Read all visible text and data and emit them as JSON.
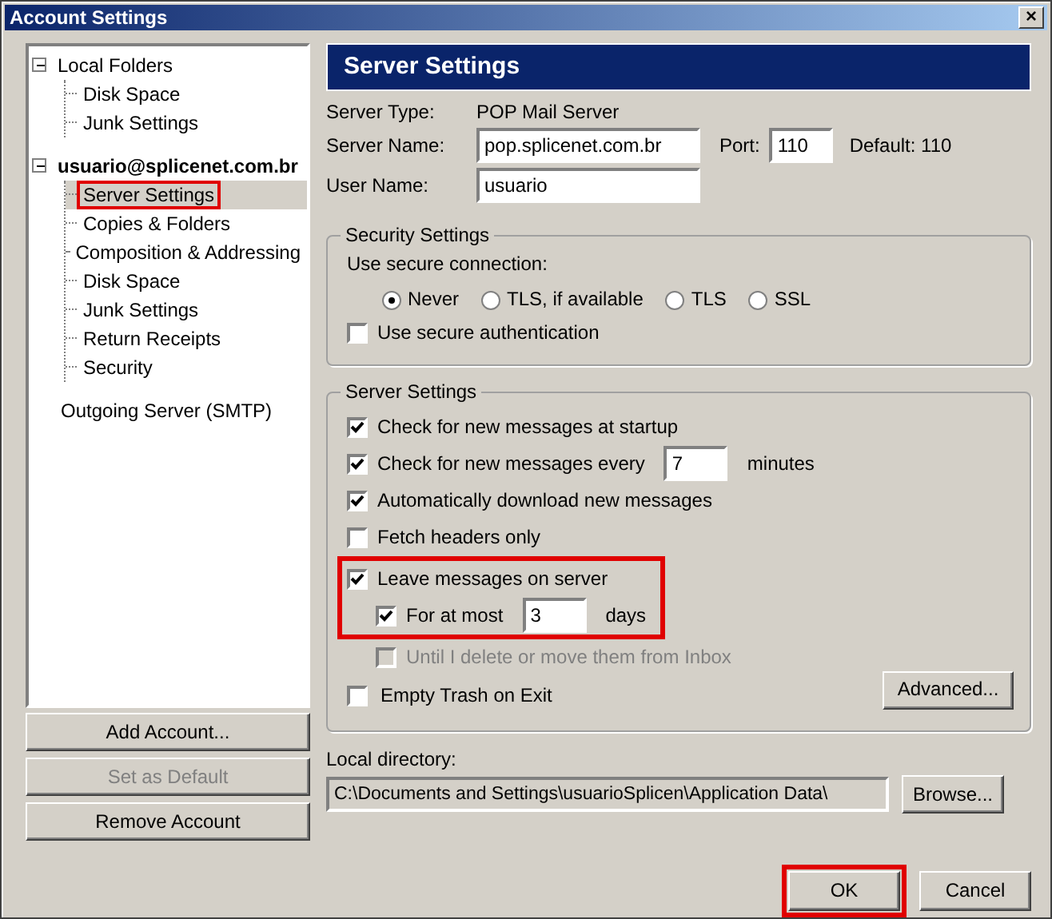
{
  "window": {
    "title": "Account Settings",
    "close": "×"
  },
  "tree": [
    {
      "label": "Local Folders",
      "kind": "folder",
      "expanded": true,
      "selected": false,
      "highlighted": false,
      "children": [
        {
          "label": "Disk Space",
          "selected": false,
          "highlighted": false
        },
        {
          "label": "Junk Settings",
          "selected": false,
          "highlighted": false
        }
      ]
    },
    {
      "label": "usuario@splicenet.com.br",
      "kind": "account",
      "expanded": true,
      "selected": false,
      "highlighted": false,
      "children": [
        {
          "label": "Server Settings",
          "selected": true,
          "highlighted": true
        },
        {
          "label": "Copies & Folders",
          "selected": false,
          "highlighted": false
        },
        {
          "label": "Composition & Addressing",
          "selected": false,
          "highlighted": false
        },
        {
          "label": "Disk Space",
          "selected": false,
          "highlighted": false
        },
        {
          "label": "Junk Settings",
          "selected": false,
          "highlighted": false
        },
        {
          "label": "Return Receipts",
          "selected": false,
          "highlighted": false
        },
        {
          "label": "Security",
          "selected": false,
          "highlighted": false
        }
      ]
    },
    {
      "label": "Outgoing Server (SMTP)",
      "kind": "folder",
      "selected": false,
      "highlighted": false
    }
  ],
  "left_buttons": [
    {
      "label": "Add Account...",
      "disabled": false
    },
    {
      "label": "Set as Default",
      "disabled": true
    },
    {
      "label": "Remove Account",
      "disabled": false
    }
  ],
  "header": "Server Settings",
  "server_type": {
    "label": "Server Type:",
    "value": "POP Mail Server"
  },
  "server_name": {
    "label": "Server Name:",
    "value": "pop.splicenet.com.br"
  },
  "port": {
    "label": "Port:",
    "value": "110",
    "default": "Default: 110"
  },
  "user_name": {
    "label": "User Name:",
    "value": "usuario"
  },
  "security": {
    "title": "Security Settings",
    "prompt": "Use secure connection:",
    "radios": [
      {
        "label": "Never",
        "selected": true
      },
      {
        "label": "TLS, if available",
        "selected": false
      },
      {
        "label": "TLS",
        "selected": false
      },
      {
        "label": "SSL",
        "selected": false
      }
    ],
    "auth": {
      "label": "Use secure authentication",
      "checked": false
    }
  },
  "server": {
    "title": "Server Settings",
    "options": [
      {
        "kind": "check",
        "label": "Check for new messages at startup",
        "checked": true,
        "disabled": false,
        "highlighted": false
      },
      {
        "kind": "check_input",
        "label": "Check for new messages every",
        "value": "7",
        "suffix": "minutes",
        "checked": true,
        "disabled": false,
        "highlighted": false
      },
      {
        "kind": "check",
        "label": "Automatically download new messages",
        "checked": true,
        "disabled": false,
        "highlighted": false
      },
      {
        "kind": "check",
        "label": "Fetch headers only",
        "checked": false,
        "disabled": false,
        "highlighted": false
      },
      {
        "kind": "check",
        "label": "Leave messages on server",
        "checked": true,
        "disabled": false,
        "highlighted": true,
        "children": [
          {
            "kind": "check_input",
            "label": "For at most",
            "value": "3",
            "suffix": "days",
            "checked": true,
            "disabled": false,
            "highlighted": true
          },
          {
            "kind": "check",
            "label": "Until I delete or move them from Inbox",
            "checked": false,
            "disabled": true,
            "highlighted": false
          }
        ]
      },
      {
        "kind": "check",
        "label": "Empty Trash on Exit",
        "checked": false,
        "disabled": false,
        "highlighted": false
      }
    ],
    "advanced": "Advanced..."
  },
  "local_directory": {
    "label": "Local directory:",
    "value": "C:\\Documents and Settings\\usuarioSplicen\\Application Data\\",
    "browse": "Browse..."
  },
  "footer_buttons": [
    {
      "label": "OK",
      "highlighted": true
    },
    {
      "label": "Cancel",
      "highlighted": false
    }
  ]
}
